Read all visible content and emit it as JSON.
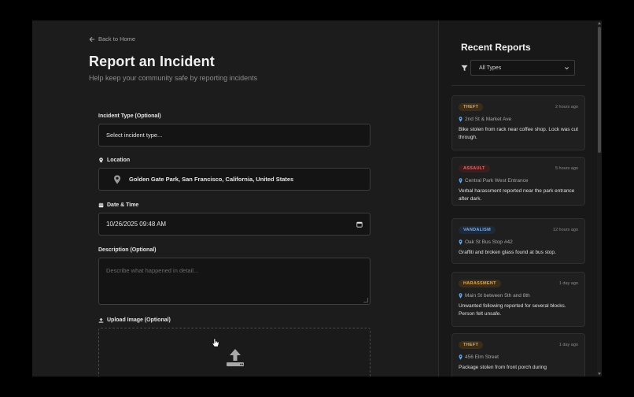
{
  "main": {
    "back_label": "Back to Home",
    "title": "Report an Incident",
    "subtitle": "Help keep your community safe by reporting incidents",
    "incident_type": {
      "label": "Incident Type (Optional)",
      "placeholder": "Select incident type..."
    },
    "location": {
      "label": "Location",
      "value": "Golden Gate Park, San Francisco, California, United States"
    },
    "datetime": {
      "label": "Date & Time",
      "value": "10/26/2025 09:48 AM"
    },
    "description": {
      "label": "Description (Optional)",
      "placeholder": "Describe what happened in detail..."
    },
    "upload": {
      "label": "Upload Image (Optional)"
    }
  },
  "sidebar": {
    "title": "Recent Reports",
    "filter": {
      "selected": "All Types"
    },
    "reports": [
      {
        "type": "THEFT",
        "time": "2 hours ago",
        "location": "2nd St & Market Ave",
        "description": "Bike stolen from rack near coffee shop. Lock was cut through.",
        "badge_color": "#e0a84a",
        "badge_bg": "#3a2e1a"
      },
      {
        "type": "ASSAULT",
        "time": "5 hours ago",
        "location": "Central Park West Entrance",
        "description": "Verbal harassment reported near the park entrance after dark.",
        "badge_color": "#e06a6a",
        "badge_bg": "#3a1e1e"
      },
      {
        "type": "VANDALISM",
        "time": "12 hours ago",
        "location": "Oak St Bus Stop #42",
        "description": "Graffiti and broken glass found at bus stop.",
        "badge_color": "#7ab0e8",
        "badge_bg": "#1c2a3c"
      },
      {
        "type": "HARASSMENT",
        "time": "1 day ago",
        "location": "Main St between 5th and 8th",
        "description": "Unwanted following reported for several blocks. Person felt unsafe.",
        "badge_color": "#e0a84a",
        "badge_bg": "#3a2e1a"
      },
      {
        "type": "THEFT",
        "time": "1 day ago",
        "location": "456 Elm Street",
        "description": "Package stolen from front porch during",
        "badge_color": "#e0a84a",
        "badge_bg": "#3a2e1a"
      }
    ]
  },
  "colors": {
    "accent": "#5b8def",
    "pin": "#6aa8f0"
  }
}
